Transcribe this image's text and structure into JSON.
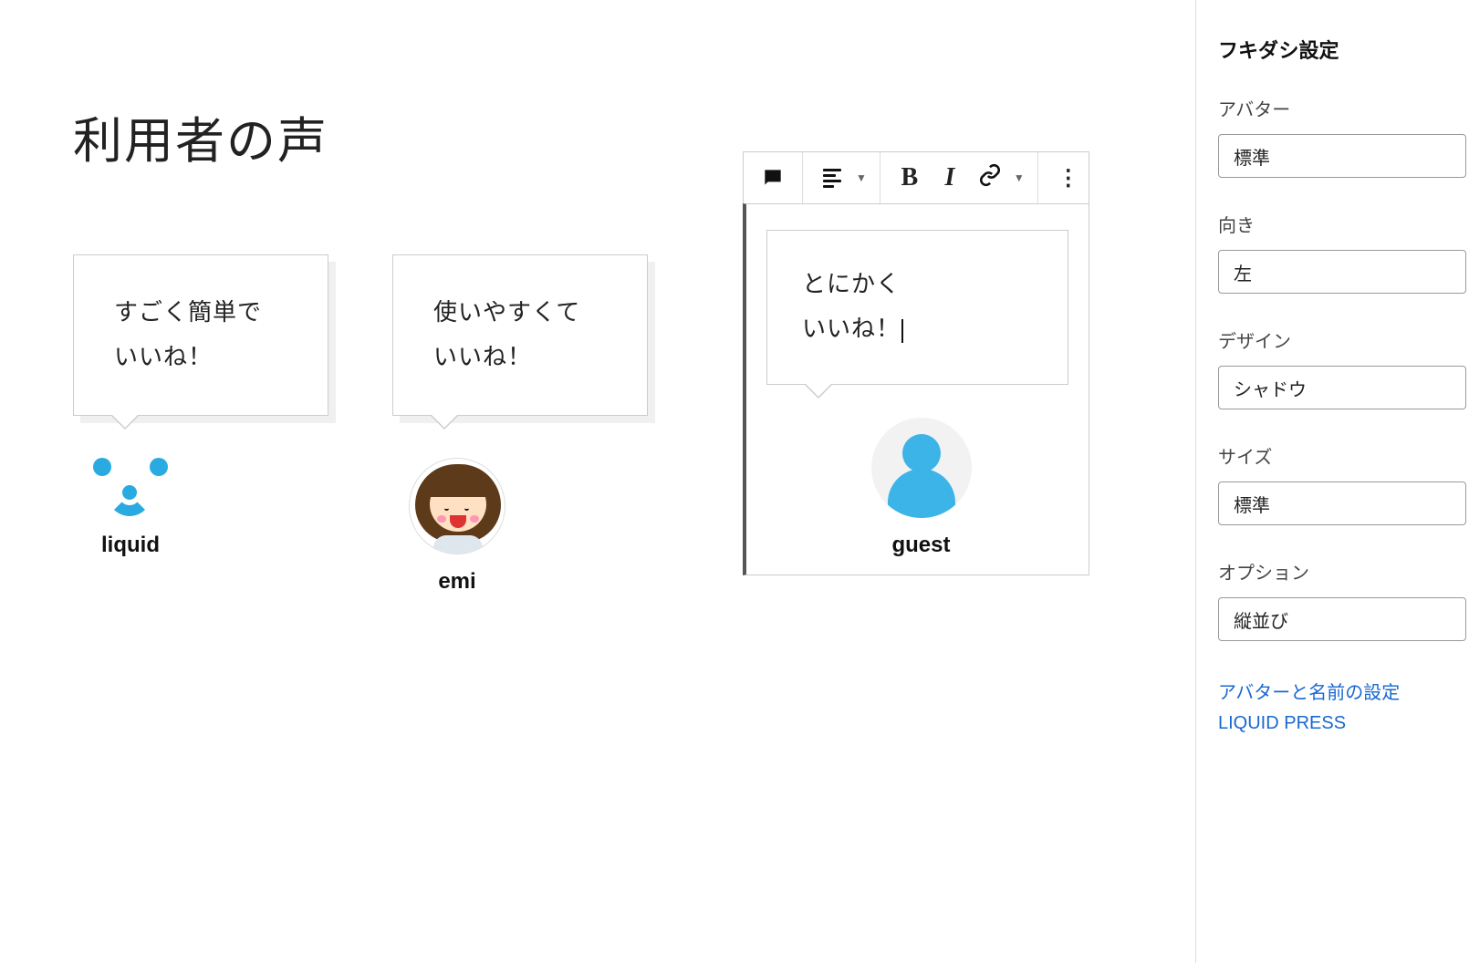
{
  "page": {
    "title": "利用者の声"
  },
  "bubbles": [
    {
      "line1": "すごく簡単で",
      "line2": "いいね！",
      "name": "liquid"
    },
    {
      "line1": "使いやすくて",
      "line2": "いいね！",
      "name": "emi"
    },
    {
      "line1": "とにかく",
      "line2": "いいね！",
      "name": "guest"
    }
  ],
  "toolbar": {
    "bold": "B",
    "italic": "I"
  },
  "sidebar": {
    "panel_title": "フキダシ設定",
    "fields": {
      "avatar": {
        "label": "アバター",
        "value": "標準"
      },
      "direction": {
        "label": "向き",
        "value": "左"
      },
      "design": {
        "label": "デザイン",
        "value": "シャドウ"
      },
      "size": {
        "label": "サイズ",
        "value": "標準"
      },
      "option": {
        "label": "オプション",
        "value": "縦並び"
      }
    },
    "links": {
      "avatar_settings": "アバターと名前の設定",
      "liquid_press": "LIQUID PRESS"
    }
  }
}
